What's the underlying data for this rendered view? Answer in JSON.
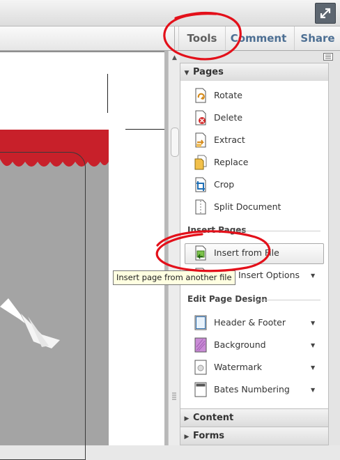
{
  "tabs": {
    "tools": "Tools",
    "comment": "Comment",
    "share": "Share"
  },
  "tools_pane": {
    "pages_header": "Pages",
    "pages_items": [
      {
        "label": "Rotate",
        "icon": "rotate-icon"
      },
      {
        "label": "Delete",
        "icon": "delete-page-icon"
      },
      {
        "label": "Extract",
        "icon": "extract-icon"
      },
      {
        "label": "Replace",
        "icon": "replace-icon"
      },
      {
        "label": "Crop",
        "icon": "crop-icon"
      },
      {
        "label": "Split Document",
        "icon": "split-document-icon"
      }
    ],
    "insert_pages_heading": "Insert Pages",
    "insert_from_file": "Insert from File",
    "more_insert_options": "More Insert Options",
    "edit_page_design_heading": "Edit Page Design",
    "design_items": [
      {
        "label": "Header & Footer",
        "icon": "header-footer-icon"
      },
      {
        "label": "Background",
        "icon": "background-icon"
      },
      {
        "label": "Watermark",
        "icon": "watermark-icon"
      },
      {
        "label": "Bates Numbering",
        "icon": "bates-numbering-icon"
      }
    ],
    "content_header": "Content",
    "forms_header": "Forms"
  },
  "tooltip": "Insert page from another file",
  "colors": {
    "annotation_red": "#e3101a",
    "tab_blue": "#4d6f93",
    "doc_red": "#c8202a"
  }
}
